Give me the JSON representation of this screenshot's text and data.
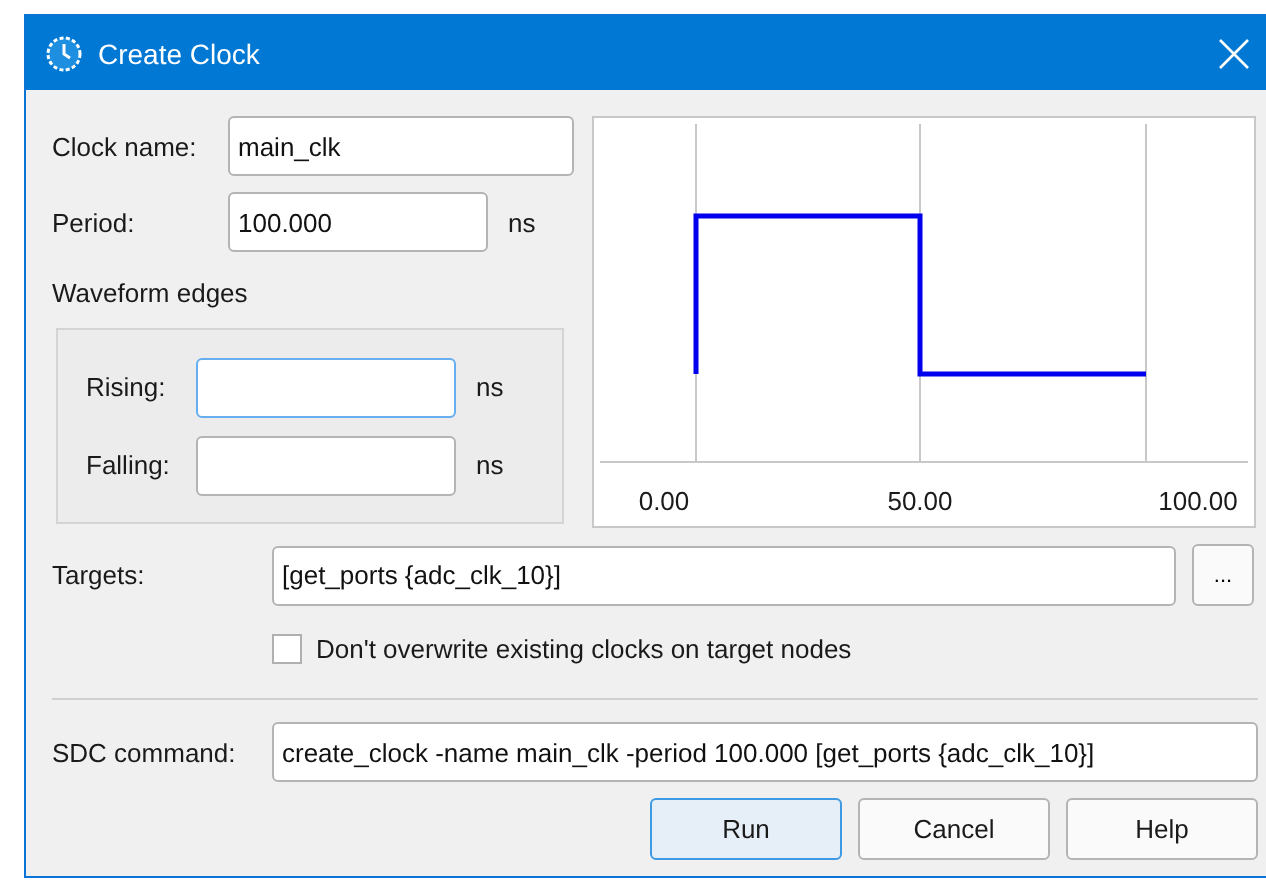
{
  "window": {
    "title": "Create Clock"
  },
  "clock_name": {
    "label": "Clock name:",
    "value": "main_clk"
  },
  "period": {
    "label": "Period:",
    "value": "100.000",
    "unit": "ns"
  },
  "waveform_edges": {
    "title": "Waveform edges",
    "rows": [
      {
        "label": "Rising:",
        "value": "",
        "unit": "ns",
        "focused": true
      },
      {
        "label": "Falling:",
        "value": "",
        "unit": "ns",
        "focused": false
      }
    ]
  },
  "preview": {
    "axis_labels": [
      "0.00",
      "50.00",
      "100.00"
    ]
  },
  "targets": {
    "label": "Targets:",
    "value": "[get_ports {adc_clk_10}]",
    "browse": "..."
  },
  "dont_overwrite": {
    "label": "Don't overwrite existing clocks on target nodes",
    "checked": false
  },
  "sdc_command": {
    "label": "SDC command:",
    "value": "create_clock -name main_clk -period 100.000 [get_ports {adc_clk_10}]"
  },
  "buttons": [
    {
      "label": "Run",
      "default": true
    },
    {
      "label": "Cancel",
      "default": false
    },
    {
      "label": "Help",
      "default": false
    }
  ]
}
